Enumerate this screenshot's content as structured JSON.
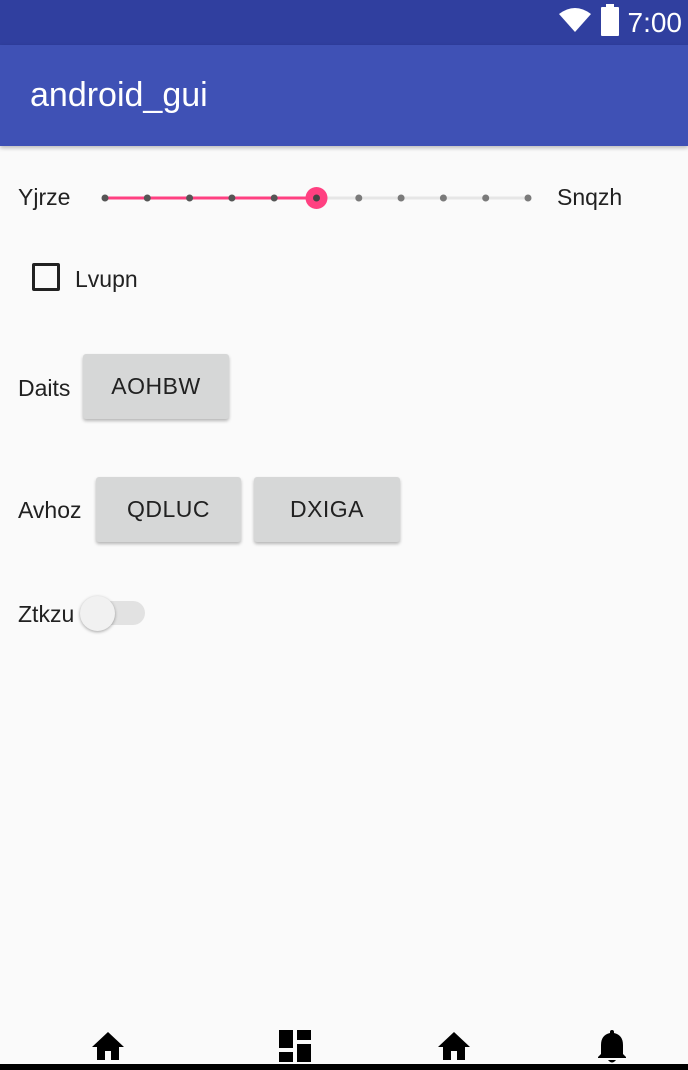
{
  "status_bar": {
    "time": "7:00",
    "icons": [
      "wifi-icon",
      "battery-icon"
    ],
    "background": "#303f9f"
  },
  "app_bar": {
    "title": "android_gui",
    "background": "#3f51b5"
  },
  "seekbar": {
    "left_label": "Yjrze",
    "right_label": "Snqzh",
    "steps": 10,
    "value": 5,
    "accent": "#ff4081"
  },
  "checkbox": {
    "label": "Lvupn",
    "checked": false
  },
  "row_daits": {
    "label": "Daits",
    "buttons": [
      "AOHBW"
    ]
  },
  "row_avhoz": {
    "label": "Avhoz",
    "buttons": [
      "QDLUC",
      "DXIGA"
    ]
  },
  "switch": {
    "label": "Ztkzu",
    "checked": false
  },
  "bottom_nav": {
    "items": [
      "home-icon",
      "dashboard-icon",
      "home-icon",
      "notifications-icon"
    ]
  }
}
